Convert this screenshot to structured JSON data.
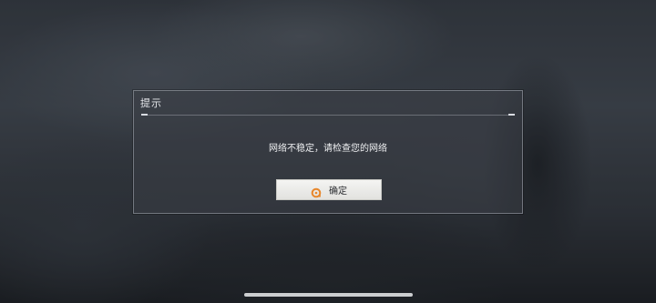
{
  "dialog": {
    "title": "提示",
    "message": "网络不稳定，请检查您的网络",
    "confirm_label": "确定"
  },
  "colors": {
    "confirm_icon": "#e8872b",
    "button_bg": "#efefec"
  }
}
